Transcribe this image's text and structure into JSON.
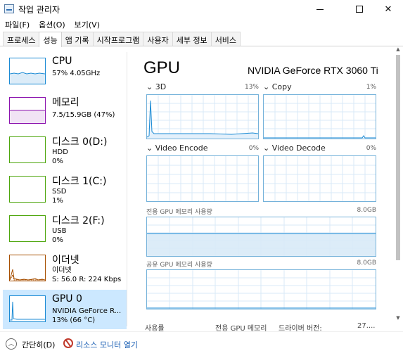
{
  "window": {
    "title": "작업 관리자",
    "minimize": "—",
    "maximize": "☐",
    "close": "✕"
  },
  "menu": [
    "파일(F)",
    "옵션(O)",
    "보기(V)"
  ],
  "tabs": [
    "프로세스",
    "성능",
    "앱 기록",
    "시작프로그램",
    "사용자",
    "세부 정보",
    "서비스"
  ],
  "active_tab": 1,
  "sidebar": {
    "items": [
      {
        "name": "CPU",
        "line1": "57% 4.05GHz",
        "line2": "",
        "color": "#1a8ad4"
      },
      {
        "name": "메모리",
        "line1": "7.5/15.9GB (47%)",
        "line2": "",
        "color": "#8b12ae"
      },
      {
        "name": "디스크 0(D:)",
        "line1": "HDD",
        "line2": "0%",
        "color": "#4da60c"
      },
      {
        "name": "디스크 1(C:)",
        "line1": "SSD",
        "line2": "1%",
        "color": "#4da60c"
      },
      {
        "name": "디스크 2(F:)",
        "line1": "USB",
        "line2": "0%",
        "color": "#4da60c"
      },
      {
        "name": "이더넷",
        "line1": "이더넷",
        "line2": "S: 56.0  R: 224 Kbps",
        "color": "#a74f01"
      },
      {
        "name": "GPU 0",
        "line1": "NVIDIA GeForce R...",
        "line2": "13% (66 °C)",
        "color": "#1a8ad4"
      }
    ]
  },
  "main": {
    "title": "GPU",
    "model": "NVIDIA GeForce RTX 3060 Ti",
    "engines": [
      {
        "label": "3D",
        "pct": "13%"
      },
      {
        "label": "Copy",
        "pct": "1%"
      },
      {
        "label": "Video Encode",
        "pct": "0%"
      },
      {
        "label": "Video Decode",
        "pct": "0%"
      }
    ],
    "dedicated_label": "전용 GPU 메모리 사용량",
    "dedicated_max": "8.0GB",
    "shared_label": "공유 GPU 메모리 사용량",
    "shared_max": "8.0GB",
    "footer": {
      "usage": "사용률",
      "dedicated": "전용 GPU 메모리",
      "driver": "드라이버 버전:",
      "driver_value": "27...."
    }
  },
  "status": {
    "collapse": "간단히(D)",
    "resource_monitor": "리소스 모니터 열기"
  },
  "colors": {
    "graph_border": "#75b2da",
    "grid": "#d9eaf7",
    "selected_bg": "#cce8ff",
    "link": "#1a5fb4"
  },
  "icons": [
    "task-manager-icon",
    "chevron-down-icon",
    "chevron-up-icon",
    "resource-monitor-icon"
  ]
}
